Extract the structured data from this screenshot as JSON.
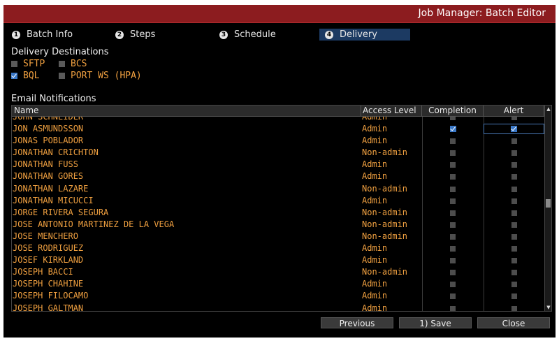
{
  "window": {
    "title": "Job Manager: Batch Editor"
  },
  "steps": [
    {
      "num": "1",
      "label": "Batch Info"
    },
    {
      "num": "2",
      "label": "Steps"
    },
    {
      "num": "3",
      "label": "Schedule"
    },
    {
      "num": "4",
      "label": "Delivery",
      "active": true
    }
  ],
  "delivery": {
    "heading": "Delivery Destinations",
    "options": [
      {
        "label": "SFTP",
        "checked": false
      },
      {
        "label": "BCS",
        "checked": false
      },
      {
        "label": "BQL",
        "checked": true
      },
      {
        "label": "PORT WS (HPA)",
        "checked": false
      }
    ]
  },
  "email": {
    "heading": "Email Notifications",
    "columns": {
      "name": "Name",
      "access": "Access Level",
      "completion": "Completion",
      "alert": "Alert"
    },
    "rows": [
      {
        "name": "JOHN SCHNEIDER",
        "access": "Admin",
        "completion": false,
        "alert": false
      },
      {
        "name": "JON ASMUNDSSON",
        "access": "Admin",
        "completion": true,
        "alert": true
      },
      {
        "name": "JONAS POBLADOR",
        "access": "Admin",
        "completion": false,
        "alert": false
      },
      {
        "name": "JONATHAN CRICHTON",
        "access": "Non-admin",
        "completion": false,
        "alert": false
      },
      {
        "name": "JONATHAN FUSS",
        "access": "Admin",
        "completion": false,
        "alert": false
      },
      {
        "name": "JONATHAN GORES",
        "access": "Admin",
        "completion": false,
        "alert": false
      },
      {
        "name": "JONATHAN LAZARE",
        "access": "Non-admin",
        "completion": false,
        "alert": false
      },
      {
        "name": "JONATHAN MICUCCI",
        "access": "Admin",
        "completion": false,
        "alert": false
      },
      {
        "name": "JORGE RIVERA SEGURA",
        "access": "Non-admin",
        "completion": false,
        "alert": false
      },
      {
        "name": "JOSE ANTONIO MARTINEZ DE LA VEGA",
        "access": "Non-admin",
        "completion": false,
        "alert": false
      },
      {
        "name": "JOSE MENCHERO",
        "access": "Non-admin",
        "completion": false,
        "alert": false
      },
      {
        "name": "JOSE RODRIGUEZ",
        "access": "Admin",
        "completion": false,
        "alert": false
      },
      {
        "name": "JOSEF KIRKLAND",
        "access": "Admin",
        "completion": false,
        "alert": false
      },
      {
        "name": "JOSEPH BACCI",
        "access": "Non-admin",
        "completion": false,
        "alert": false
      },
      {
        "name": "JOSEPH CHAHINE",
        "access": "Admin",
        "completion": false,
        "alert": false
      },
      {
        "name": "JOSEPH FILOCAMO",
        "access": "Admin",
        "completion": false,
        "alert": false
      },
      {
        "name": "JOSEPH GALTMAN",
        "access": "Admin",
        "completion": false,
        "alert": false
      }
    ]
  },
  "buttons": {
    "previous": "Previous",
    "save": "1) Save",
    "close": "Close"
  },
  "colors": {
    "title_bar": "#8c1c1f",
    "accent_text": "#f0a040",
    "active_step": "#1c3a62",
    "checked": "#3a78c8"
  }
}
